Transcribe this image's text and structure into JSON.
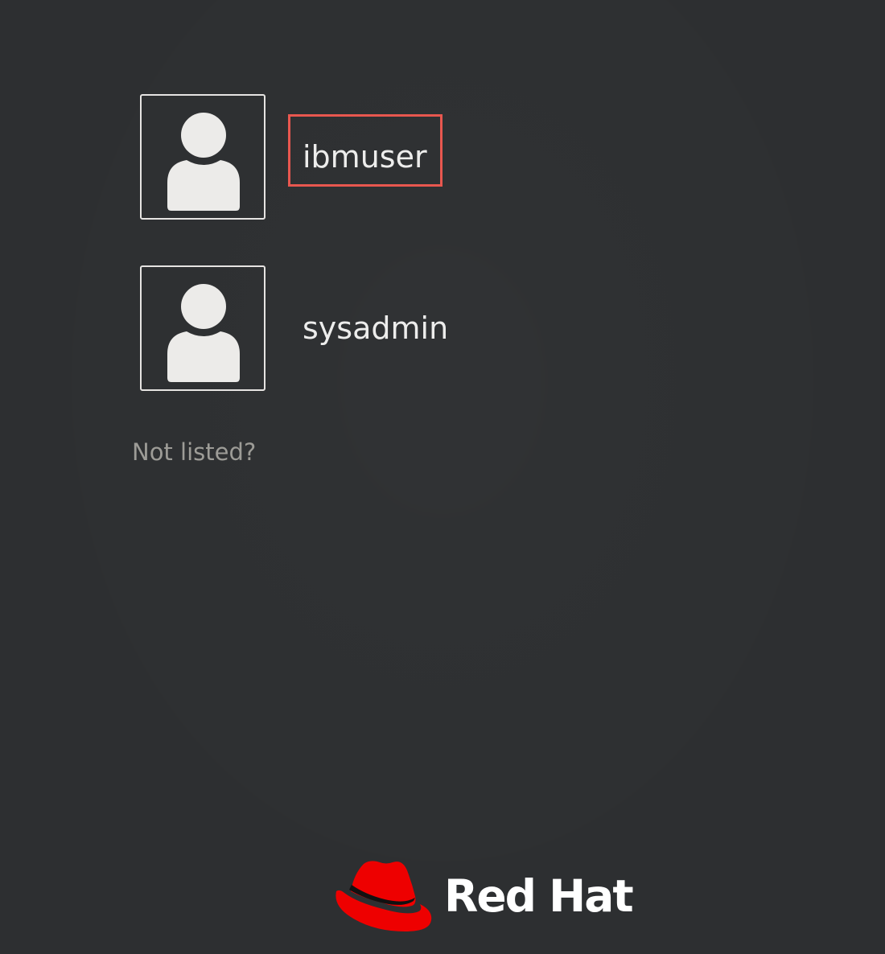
{
  "users": [
    {
      "name": "ibmuser",
      "icon": "user-avatar-icon"
    },
    {
      "name": "sysadmin",
      "icon": "user-avatar-icon"
    }
  ],
  "not_listed_label": "Not listed?",
  "brand": {
    "text": "Red Hat",
    "logo_icon": "red-hat-fedora-icon",
    "logo_color": "#ee0000"
  },
  "colors": {
    "background": "#2d2f31",
    "avatar_border": "#e6e4e2",
    "username_text": "#ededec",
    "muted_text": "#9d9c97",
    "highlight": "#e8574f"
  }
}
